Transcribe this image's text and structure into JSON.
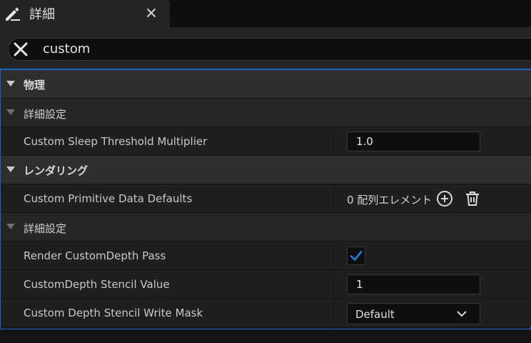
{
  "tab": {
    "title": "詳細",
    "icon": "pencil-icon",
    "close_icon": "close-icon"
  },
  "search": {
    "value": "custom",
    "placeholder": "",
    "clear_icon": "clear-icon"
  },
  "colors": {
    "accent": "#1a66c8",
    "checkbox_check": "#2a7fe0"
  },
  "sections": {
    "physics": {
      "title": "物理",
      "advanced": {
        "title": "詳細設定",
        "sleep_label": "Custom Sleep Threshold Multiplier",
        "sleep_value": "1.0"
      }
    },
    "rendering": {
      "title": "レンダリング",
      "primitive_label": "Custom Primitive Data Defaults",
      "primitive_value": "0 配列エレメント",
      "add_icon": "add-circle-icon",
      "delete_icon": "trash-icon",
      "advanced": {
        "title": "詳細設定",
        "depth_pass_label": "Render CustomDepth Pass",
        "depth_pass_checked": true,
        "stencil_label": "CustomDepth Stencil Value",
        "stencil_value": "1",
        "write_mask_label": "Custom Depth Stencil Write Mask",
        "write_mask_value": "Default"
      }
    }
  }
}
